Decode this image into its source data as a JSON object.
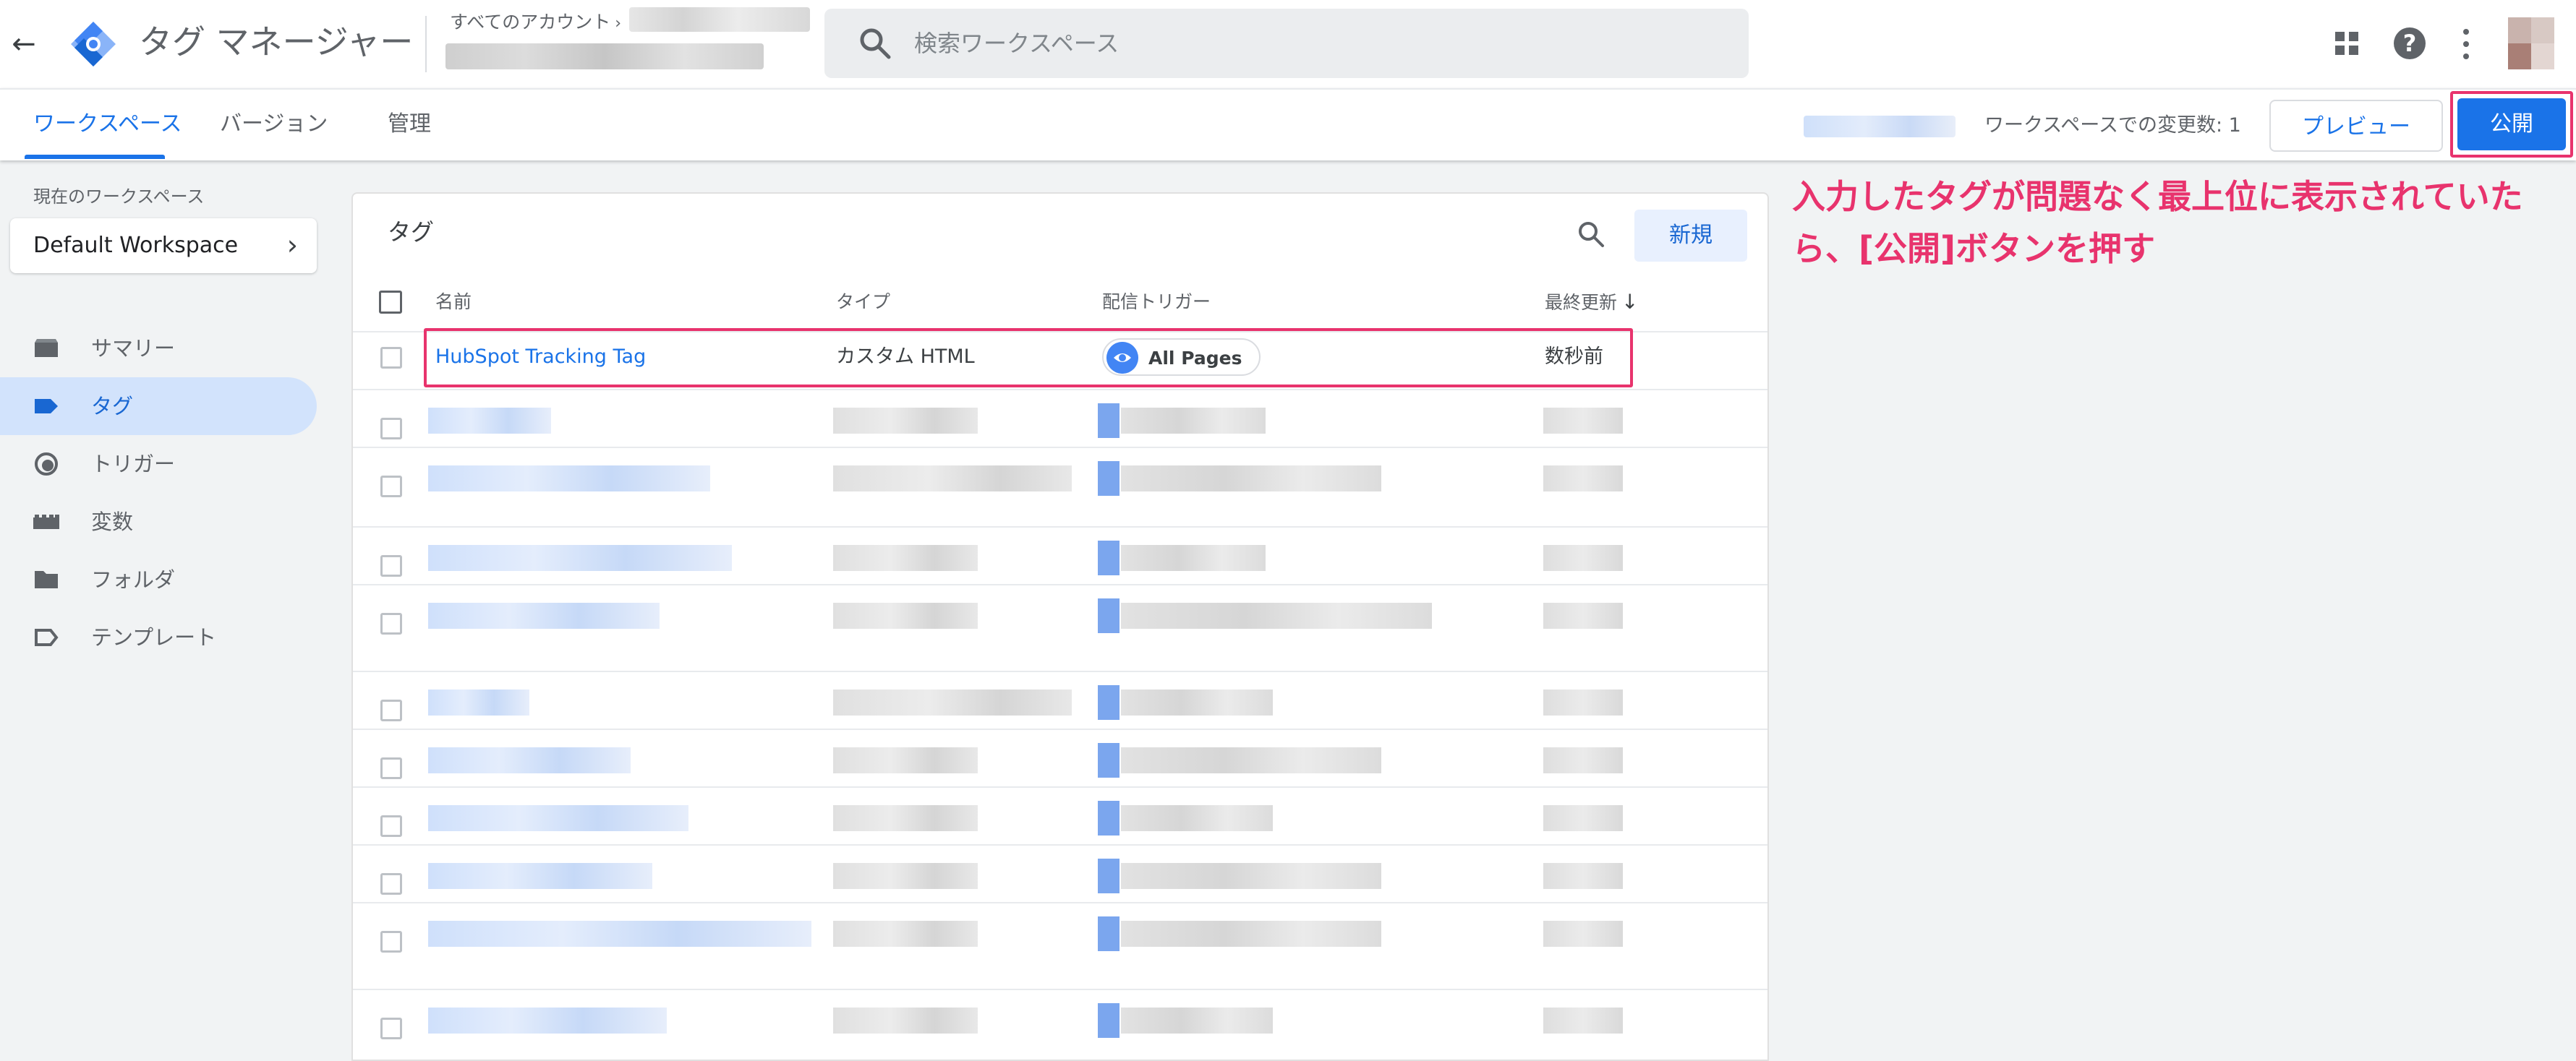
{
  "header": {
    "back_icon": "arrow-left-icon",
    "logo_icon": "gtm-logo-icon",
    "app_title": "タグ マネージャー",
    "account_label": "すべてのアカウント",
    "search_placeholder": "検索ワークスペース",
    "icons": [
      "apps-grid-icon",
      "help-icon",
      "more-vert-icon",
      "avatar"
    ]
  },
  "tabs": {
    "items": [
      {
        "label": "ワークスペース",
        "active": true
      },
      {
        "label": "バージョン",
        "active": false
      },
      {
        "label": "管理",
        "active": false
      }
    ],
    "changes_text": "ワークスペースでの変更数: 1",
    "preview_label": "プレビュー",
    "publish_label": "公開"
  },
  "sidebar": {
    "workspace_caption": "現在のワークスペース",
    "workspace_name": "Default Workspace",
    "items": [
      {
        "label": "サマリー",
        "icon": "summary-icon",
        "active": false
      },
      {
        "label": "タグ",
        "icon": "tag-icon",
        "active": true
      },
      {
        "label": "トリガー",
        "icon": "trigger-icon",
        "active": false
      },
      {
        "label": "変数",
        "icon": "variables-icon",
        "active": false
      },
      {
        "label": "フォルダ",
        "icon": "folder-icon",
        "active": false
      },
      {
        "label": "テンプレート",
        "icon": "template-icon",
        "active": false
      }
    ]
  },
  "tags_panel": {
    "title": "タグ",
    "new_label": "新規",
    "columns": [
      "名前",
      "タイプ",
      "配信トリガー",
      "最終更新"
    ],
    "first_row": {
      "name": "HubSpot Tracking Tag",
      "type": "カスタム HTML",
      "trigger": "All Pages",
      "updated": "数秒前"
    },
    "blurred_row_count": 11
  },
  "annotation": {
    "line1": "入力したタグが問題なく最上位に表示されていた",
    "line2": "ら、[公開]ボタンを押す"
  },
  "colors": {
    "accent": "#1a73e8",
    "highlight": "#e8336d",
    "nav_active_bg": "#d2e3fc",
    "page_bg": "#f1f3f4"
  }
}
